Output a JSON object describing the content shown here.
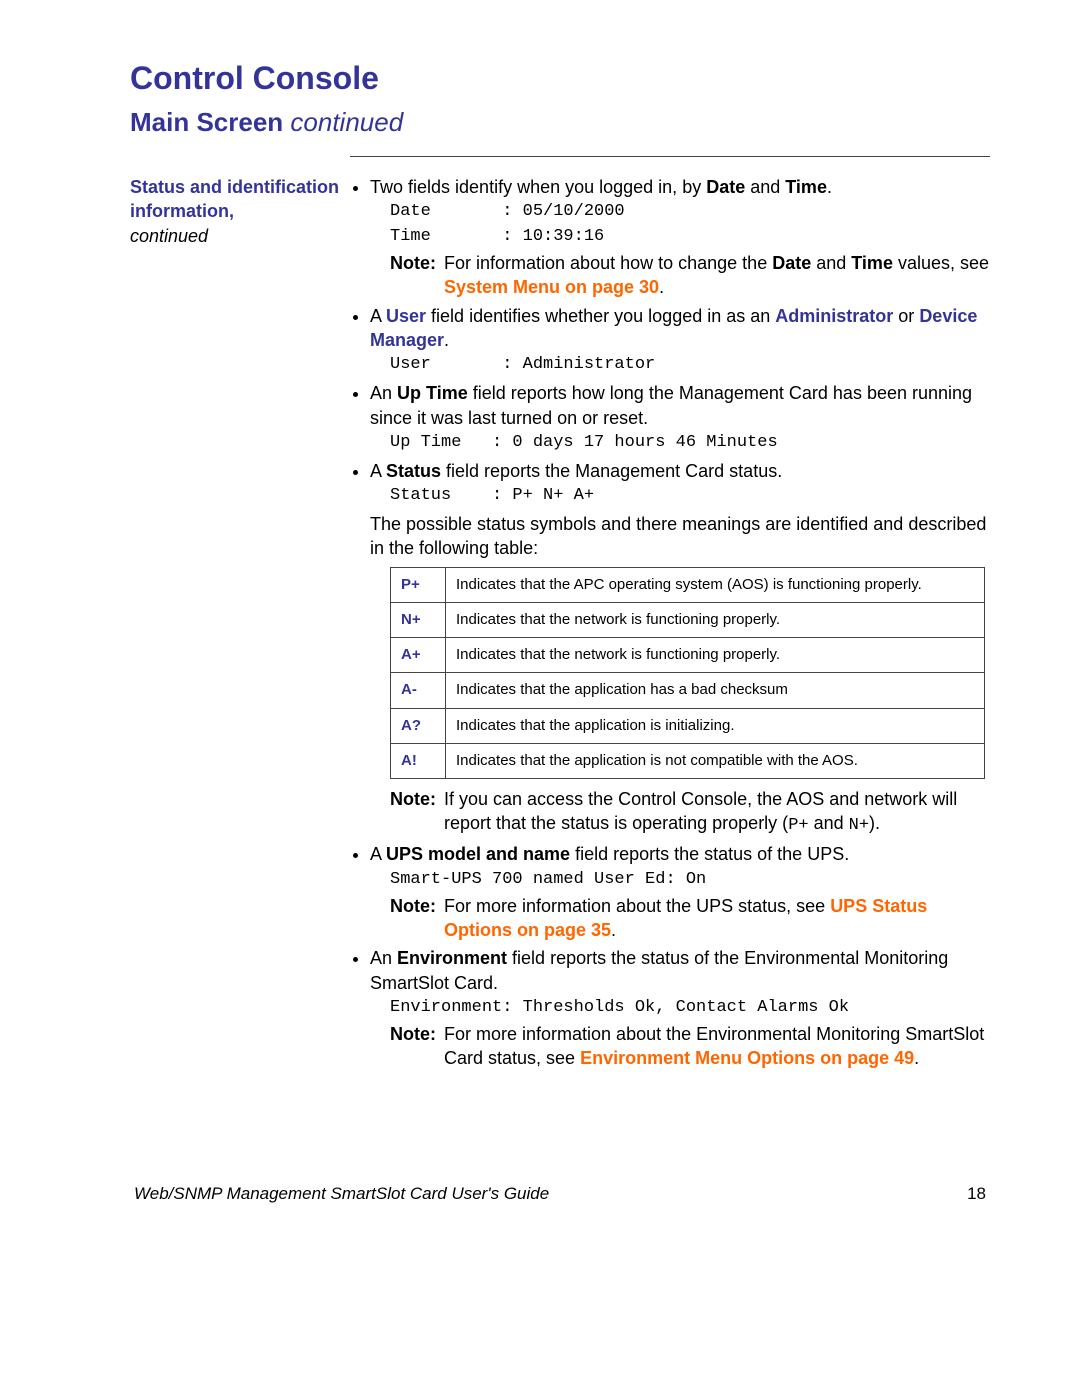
{
  "title": "Control Console",
  "subtitle_main": "Main Screen",
  "subtitle_cont": "continued",
  "sidebar_heading": "Status and identification information,",
  "sidebar_cont": "continued",
  "bullet1_pre": "Two fields identify when you logged in, by ",
  "bullet1_date": "Date",
  "bullet1_mid": " and ",
  "bullet1_time": "Time",
  "bullet1_post": ".",
  "mono_date": "Date       : 05/10/2000",
  "mono_time": "Time       : 10:39:16",
  "note1_label": "Note:",
  "note1_pre": "For information about how to change the ",
  "note1_date": "Date",
  "note1_mid": " and ",
  "note1_time": "Time",
  "note1_mid2": " values, see ",
  "note1_link": "System Menu on page 30",
  "note1_post": ".",
  "bullet2_pre": "A ",
  "bullet2_user": "User",
  "bullet2_mid": " field identifies whether you logged in as an ",
  "bullet2_admin": "Administrator",
  "bullet2_or": " or ",
  "bullet2_dev": "Device Manager",
  "bullet2_post": ".",
  "mono_user": "User       : Administrator",
  "bullet3_pre": "An ",
  "bullet3_up": "Up Time",
  "bullet3_post": " field reports how long the Management Card has been running since it was last turned on or reset.",
  "mono_uptime": "Up Time   : 0 days 17 hours 46 Minutes",
  "bullet4_pre": "A ",
  "bullet4_status": "Status",
  "bullet4_post": " field reports the Management Card status.",
  "mono_status": "Status    : P+ N+ A+",
  "para_statusdesc": "The possible status symbols and there meanings are identified and described in the following table:",
  "table": [
    {
      "sym": "P+",
      "desc": "Indicates that the APC operating system (AOS) is functioning properly."
    },
    {
      "sym": "N+",
      "desc": "Indicates that the network is functioning properly."
    },
    {
      "sym": "A+",
      "desc": "Indicates that the network is functioning properly."
    },
    {
      "sym": "A-",
      "desc": "Indicates that the application has a bad checksum"
    },
    {
      "sym": "A?",
      "desc": "Indicates that the application is initializing."
    },
    {
      "sym": "A!",
      "desc": "Indicates that the application is not compatible with the AOS."
    }
  ],
  "note2_label": "Note:",
  "note2_pre": "If you can access the Control Console, the AOS and network will report that the status is operating properly (",
  "note2_p": "P+",
  "note2_mid": " and ",
  "note2_n": "N+",
  "note2_post": ").",
  "bullet5_pre": "A ",
  "bullet5_ups": "UPS model and name",
  "bullet5_post": " field reports the status of the UPS.",
  "mono_ups": "Smart-UPS 700 named User Ed: On",
  "note3_label": "Note:",
  "note3_pre": "For more information about the UPS status, see ",
  "note3_link": "UPS Status Options on page 35",
  "note3_post": ".",
  "bullet6_pre": "An ",
  "bullet6_env": "Environment",
  "bullet6_post": " field reports the status of the Environmental Monitoring SmartSlot Card.",
  "mono_env": "Environment: Thresholds Ok, Contact Alarms Ok",
  "note4_label": "Note:",
  "note4_pre": "For more information about the Environmental Monitoring SmartSlot Card status, see ",
  "note4_link": "Environment Menu Options on page 49",
  "note4_post": ".",
  "footer_title": "Web/SNMP Management SmartSlot Card User's Guide",
  "footer_page": "18"
}
